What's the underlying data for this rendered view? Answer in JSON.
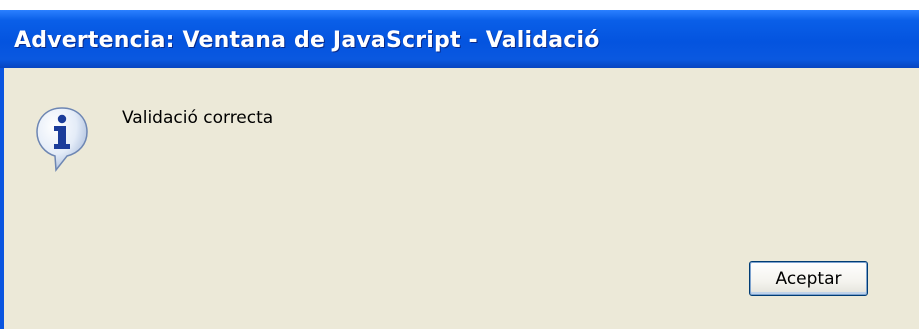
{
  "dialog": {
    "title": "Advertencia: Ventana de JavaScript - Validació",
    "message": "Validació correcta",
    "icon": "info-icon",
    "ok_label": "Aceptar"
  },
  "colors": {
    "titlebar": "#0454df",
    "body": "#ece9d8",
    "button_border": "#003c74"
  }
}
